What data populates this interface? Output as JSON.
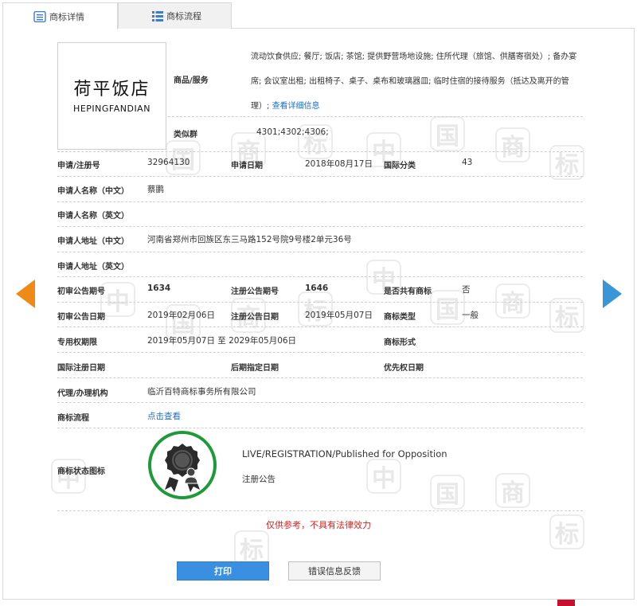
{
  "tabs": [
    {
      "label": "商标详情",
      "icon": "document-icon",
      "active": true
    },
    {
      "label": "商标流程",
      "icon": "list-icon",
      "active": false
    }
  ],
  "watermark_chars": [
    "中",
    "国",
    "商",
    "标"
  ],
  "logo": {
    "cn": "荷平饭店",
    "en": "HEPINGFANDIAN"
  },
  "goods": {
    "label": "商品/服务",
    "text": "流动饮食供应; 餐厅; 饭店; 茶馆; 提供野营场地设施; 住所代理（旅馆、供膳寄宿处）; 备办宴席; 会议室出租; 出租椅子、桌子、桌布和玻璃器皿; 临时住宿的接待服务（抵达及离开的管理）; ",
    "link": "查看详细信息"
  },
  "similar_group": {
    "label": "类似群",
    "value": "4301;4302;4306;"
  },
  "fields": {
    "reg_no": {
      "label": "申请/注册号",
      "value": "32964130"
    },
    "app_date": {
      "label": "申请日期",
      "value": "2018年08月17日"
    },
    "intl_class": {
      "label": "国际分类",
      "value": "43"
    },
    "applicant_cn": {
      "label": "申请人名称（中文）",
      "value": "蔡鹏"
    },
    "applicant_en": {
      "label": "申请人名称（英文）",
      "value": ""
    },
    "address_cn": {
      "label": "申请人地址（中文）",
      "value": "河南省郑州市回族区东三马路152号院9号楼2单元36号"
    },
    "address_en": {
      "label": "申请人地址（英文）",
      "value": ""
    },
    "prelim_pub_no": {
      "label": "初审公告期号",
      "value": "1634"
    },
    "reg_pub_no": {
      "label": "注册公告期号",
      "value": "1646"
    },
    "shared": {
      "label": "是否共有商标",
      "value": "否"
    },
    "prelim_pub_date": {
      "label": "初审公告日期",
      "value": "2019年02月06日"
    },
    "reg_pub_date": {
      "label": "注册公告日期",
      "value": "2019年05月07日"
    },
    "tm_type": {
      "label": "商标类型",
      "value": "一般"
    },
    "exclusive_period": {
      "label": "专用权期限",
      "value": "2019年05月07日 至 2029年05月06日"
    },
    "tm_form": {
      "label": "商标形式",
      "value": ""
    },
    "intl_reg_date": {
      "label": "国际注册日期",
      "value": ""
    },
    "later_designation_date": {
      "label": "后期指定日期",
      "value": ""
    },
    "priority_date": {
      "label": "优先权日期",
      "value": ""
    },
    "agency": {
      "label": "代理/办理机构",
      "value": "临沂百特商标事务所有限公司"
    },
    "tm_process": {
      "label": "商标流程",
      "value": "点击查看"
    }
  },
  "status": {
    "label": "商标状态图标",
    "text_en": "LIVE/REGISTRATION/Published for Opposition",
    "text_cn": "注册公告",
    "seal_color": "#1f9a3a"
  },
  "disclaimer": "仅供参考，不具有法律效力",
  "buttons": {
    "print": "打印",
    "feedback": "错误信息反馈"
  },
  "colors": {
    "accent": "#3a8fe0",
    "link": "#1a6fc4",
    "prev_arrow": "#f08a17",
    "next_arrow": "#3a96d8",
    "warning": "#e02020"
  }
}
